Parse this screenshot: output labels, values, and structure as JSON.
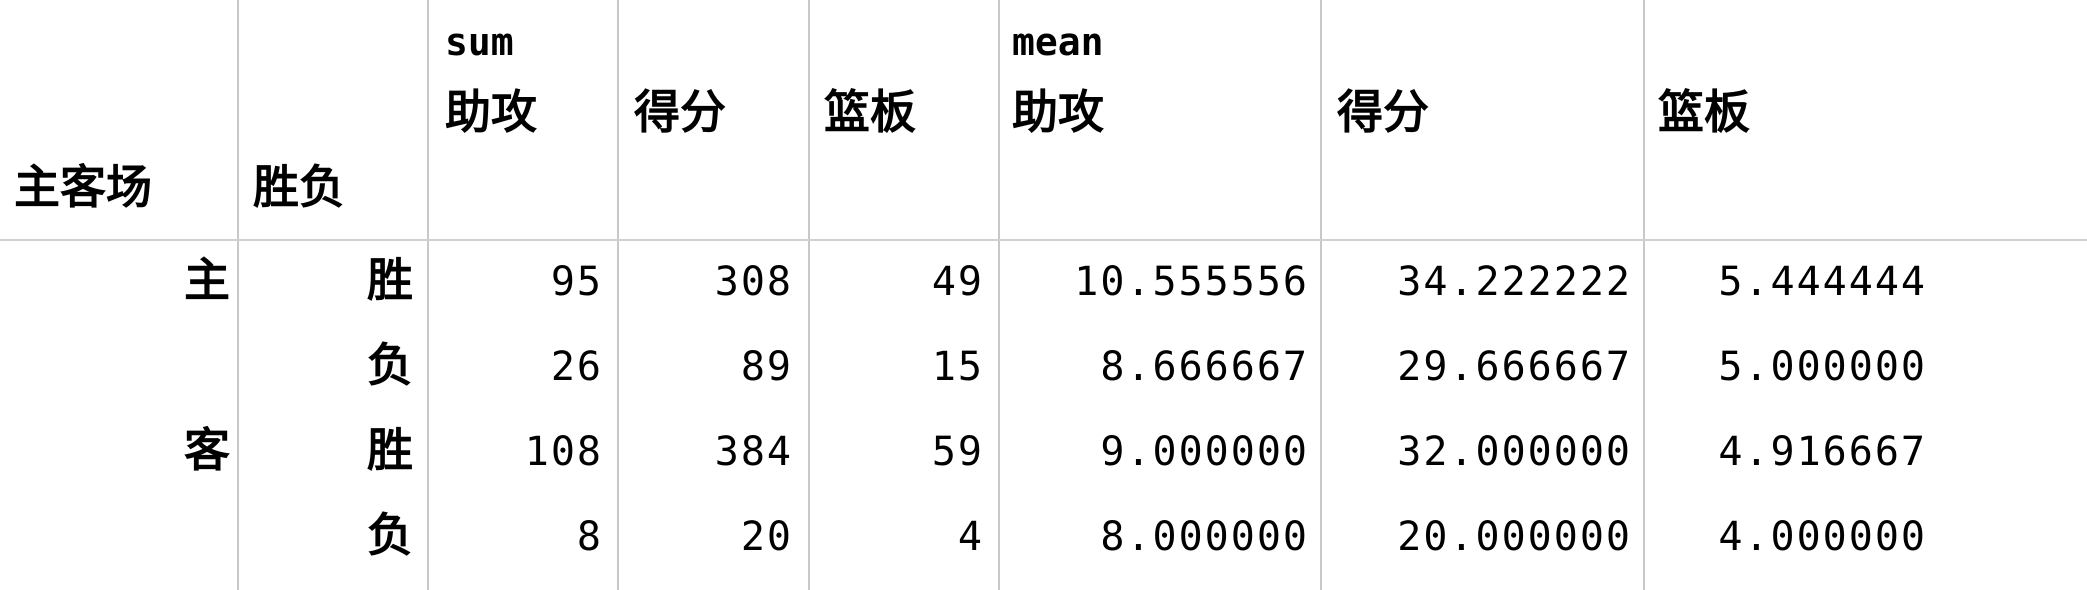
{
  "header": {
    "group_sum": "sum",
    "group_mean": "mean",
    "index_name_1": "主客场",
    "index_name_2": "胜负",
    "columns": [
      "助攻",
      "得分",
      "篮板",
      "助攻",
      "得分",
      "篮板"
    ]
  },
  "rows": [
    {
      "level1": "主",
      "level2": "胜",
      "values": [
        "95",
        "308",
        "49",
        "10.555556",
        "34.222222",
        "5.444444"
      ]
    },
    {
      "level1": "",
      "level2": "负",
      "values": [
        "26",
        "89",
        "15",
        "8.666667",
        "29.666667",
        "5.000000"
      ]
    },
    {
      "level1": "客",
      "level2": "胜",
      "values": [
        "108",
        "384",
        "59",
        "9.000000",
        "32.000000",
        "4.916667"
      ]
    },
    {
      "level1": "",
      "level2": "负",
      "values": [
        "8",
        "20",
        "4",
        "8.000000",
        "20.000000",
        "4.000000"
      ]
    }
  ]
}
